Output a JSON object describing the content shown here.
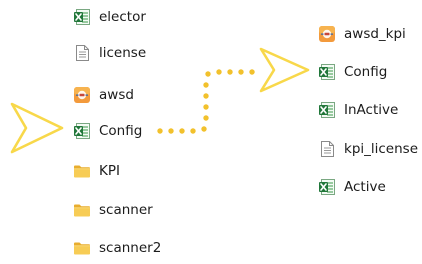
{
  "colors": {
    "arrow": "#f8d84a",
    "dots": "#f2c12c",
    "excel_green": "#2e8a3e",
    "folder": "#f5c54a",
    "doc_gray": "#8a8a8a",
    "text": "#1c1c1c"
  },
  "left_column": {
    "items": [
      {
        "label": "elector",
        "icon": "excel-file-icon"
      },
      {
        "label": "license",
        "icon": "text-file-icon"
      },
      {
        "label": "awsd",
        "icon": "app-logo-icon"
      },
      {
        "label": "Config",
        "icon": "excel-file-icon"
      },
      {
        "label": "KPI",
        "icon": "folder-icon"
      },
      {
        "label": "scanner",
        "icon": "folder-icon"
      },
      {
        "label": "scanner2",
        "icon": "folder-icon"
      }
    ]
  },
  "right_column": {
    "items": [
      {
        "label": "awsd_kpi",
        "icon": "app-logo-icon"
      },
      {
        "label": "Config",
        "icon": "excel-file-icon"
      },
      {
        "label": "InActive",
        "icon": "excel-file-icon"
      },
      {
        "label": "kpi_license",
        "icon": "text-file-icon"
      },
      {
        "label": "Active",
        "icon": "excel-file-icon"
      }
    ]
  }
}
